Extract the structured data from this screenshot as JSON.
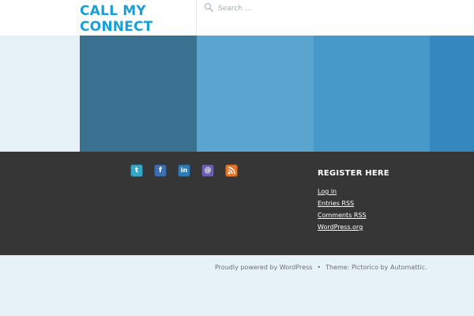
{
  "header": {
    "site_title": "CALL MY CONNECT",
    "search": {
      "placeholder": "Search …",
      "value": ""
    }
  },
  "colors": {
    "title": "#1a9fd9",
    "tiles": [
      "#e6f1f8",
      "#3b7190",
      "#5aa5cf",
      "#4799c9",
      "#3588bf"
    ],
    "footer_bg": "#363636",
    "page_bg": "#e6f1f8"
  },
  "social": [
    {
      "name": "twitter-icon",
      "glyph": "t",
      "color": "#36a7c9"
    },
    {
      "name": "facebook-icon",
      "glyph": "f",
      "color": "#3b6fb0"
    },
    {
      "name": "linkedin-icon",
      "glyph": "in",
      "color": "#2f7bb5"
    },
    {
      "name": "email-icon",
      "glyph": "@",
      "color": "#6a5fb0"
    },
    {
      "name": "rss-icon",
      "glyph": "",
      "color": "#e6742a"
    }
  ],
  "widget": {
    "title": "REGISTER HERE",
    "links": [
      "Log in",
      "Entries RSS",
      "Comments RSS",
      "WordPress.org"
    ]
  },
  "site_info": {
    "powered": "Proudly powered by WordPress",
    "separator": "•",
    "theme_prefix": "Theme: Pictorico by ",
    "theme_author": "Automattic",
    "theme_suffix": "."
  }
}
